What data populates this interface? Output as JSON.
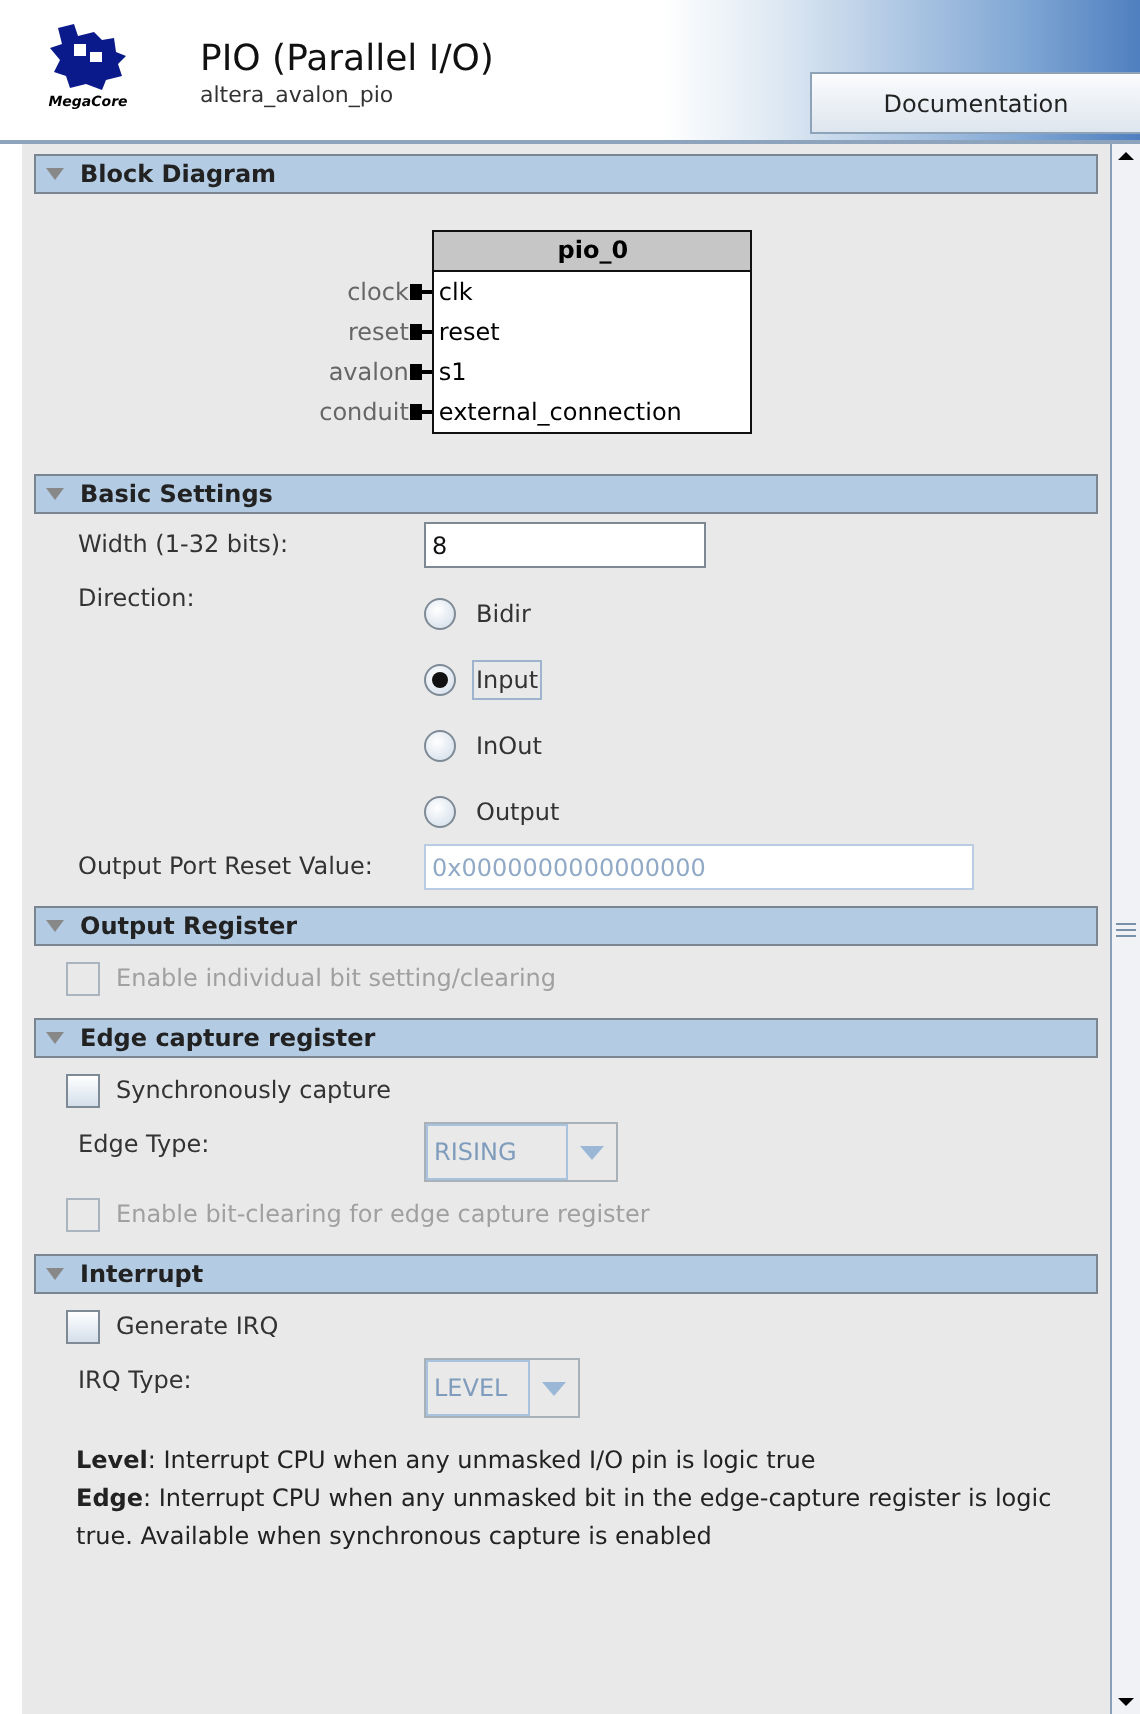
{
  "header": {
    "logo_text": "MegaCore",
    "title": "PIO (Parallel I/O)",
    "subtitle": "altera_avalon_pio",
    "button": "Documentation"
  },
  "sections": [
    {
      "title": "Block Diagram",
      "expanded": true,
      "kind": "diagram",
      "diagram": {
        "name": "pio_0",
        "ports": [
          {
            "interface": "clock",
            "port": "clk"
          },
          {
            "interface": "reset",
            "port": "reset"
          },
          {
            "interface": "avalon",
            "port": "s1"
          },
          {
            "interface": "conduit",
            "port": "external_connection"
          }
        ]
      }
    },
    {
      "title": "Basic Settings",
      "expanded": true,
      "kind": "form",
      "rows": [
        {
          "kind": "text_field",
          "label": "Width (1-32 bits):",
          "value": "8",
          "disabled": false
        },
        {
          "kind": "radio_group",
          "label": "Direction:",
          "options": [
            {
              "label": "Bidir",
              "selected": false
            },
            {
              "label": "Input",
              "selected": true
            },
            {
              "label": "InOut",
              "selected": false
            },
            {
              "label": "Output",
              "selected": false
            }
          ]
        },
        {
          "kind": "text_field",
          "label": "Output Port Reset Value:",
          "value": "0x0000000000000000",
          "disabled": true
        }
      ]
    },
    {
      "title": "Output Register",
      "expanded": true,
      "kind": "form",
      "rows": [
        {
          "kind": "checkbox",
          "label": "Enable individual bit setting/clearing",
          "checked": false,
          "disabled": true
        }
      ]
    },
    {
      "title": "Edge capture register",
      "expanded": true,
      "kind": "form",
      "rows": [
        {
          "kind": "checkbox",
          "label": "Synchronously capture",
          "checked": false,
          "disabled": false
        },
        {
          "kind": "dropdown",
          "label": "Edge Type:",
          "value": "RISING",
          "disabled": true
        },
        {
          "kind": "checkbox",
          "label": "Enable bit-clearing for edge capture register",
          "checked": false,
          "disabled": true
        }
      ]
    },
    {
      "title": "Interrupt",
      "expanded": true,
      "kind": "form",
      "rows": [
        {
          "kind": "checkbox",
          "label": "Generate IRQ",
          "checked": false,
          "disabled": false
        },
        {
          "kind": "dropdown",
          "label": "IRQ Type:",
          "value": "LEVEL",
          "disabled": true
        },
        {
          "kind": "note",
          "paragraphs": [
            "**Level**: Interrupt CPU when any unmasked I/O pin is logic true",
            "**Edge**: Interrupt CPU when any unmasked bit in the edge-capture register is logic true. Available when synchronous capture is enabled"
          ]
        }
      ]
    }
  ]
}
